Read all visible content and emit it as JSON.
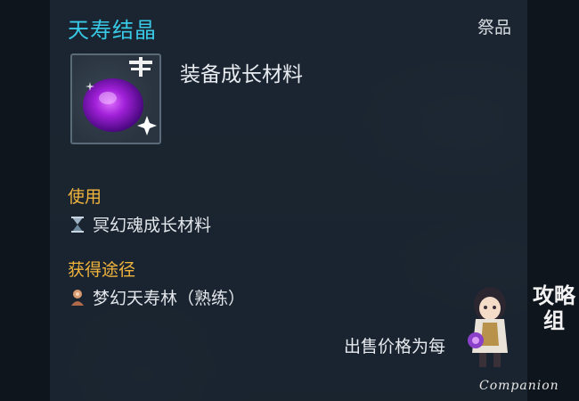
{
  "tooltip": {
    "title": "天寿结晶",
    "category": "祭品",
    "item_type": "装备成长材料",
    "item_icon": "purple-crystal-icon",
    "usage": {
      "label": "使用",
      "item_icon": "hourglass-icon",
      "item_text": "冥幻魂成长材料"
    },
    "acquisition": {
      "label": "获得途径",
      "item_icon": "character-icon",
      "item_text": "梦幻天寿林（熟练）"
    },
    "price_text": "出售价格为每"
  },
  "watermark": {
    "site_mark": "攻略组",
    "brand": "Companion"
  },
  "colors": {
    "title": "#38c9e6",
    "section_label": "#f0b43c",
    "text": "#e2e6ea",
    "panel_bg": "#1a2430"
  }
}
